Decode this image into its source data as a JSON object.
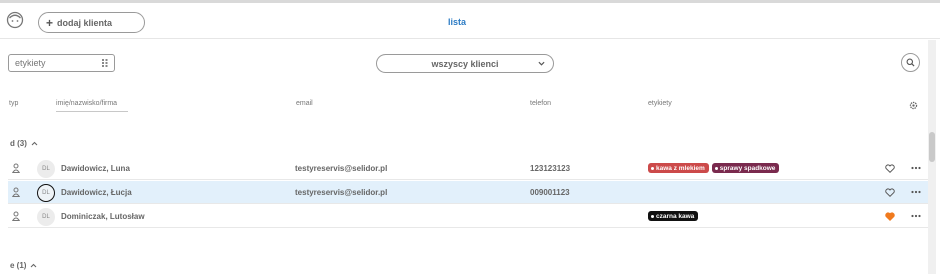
{
  "header": {
    "add_client_label": "dodaj klienta",
    "tab_label": "lista"
  },
  "filters": {
    "tags_placeholder": "etykiety",
    "clients_filter_value": "wszyscy klienci"
  },
  "columns": {
    "type": "typ",
    "name_filter_placeholder": "imię/nazwisko/firma",
    "email": "email",
    "phone": "telefon",
    "tags": "etykiety"
  },
  "groups": [
    {
      "label": "d (3)",
      "rows": [
        {
          "initials": "DL",
          "name": "Dawidowicz, Luna",
          "email": "testyreservis@selidor.pl",
          "phone": "123123123",
          "tags": [
            {
              "label": "kawa z mlekiem",
              "color": "#cc4a4a"
            },
            {
              "label": "sprawy spadkowe",
              "color": "#7a2a4e"
            }
          ],
          "favorite": false,
          "selected": false
        },
        {
          "initials": "DL",
          "name": "Dawidowicz, Łucja",
          "email": "testyreservis@selidor.pl",
          "phone": "009001123",
          "tags": [],
          "favorite": false,
          "selected": true
        },
        {
          "initials": "DL",
          "name": "Dominiczak, Lutosław",
          "email": "",
          "phone": "",
          "tags": [
            {
              "label": "czarna kawa",
              "color": "#111111"
            }
          ],
          "favorite": true,
          "selected": false
        }
      ]
    },
    {
      "label": "e (1)",
      "rows": []
    }
  ],
  "colors": {
    "accent": "#2b7bc4",
    "favorite": "#f07a1e",
    "selected_row": "#e2f0fb"
  },
  "icons": {
    "logo": "user-face-icon",
    "add": "plus-icon",
    "tags_select": "grid-icon",
    "clients_select": "chevron-down-icon",
    "search": "search-icon",
    "settings": "gear-icon",
    "group_toggle": "chevron-up-icon",
    "row_type": "person-icon",
    "favorite": "heart-icon",
    "more": "more-dots-icon"
  }
}
